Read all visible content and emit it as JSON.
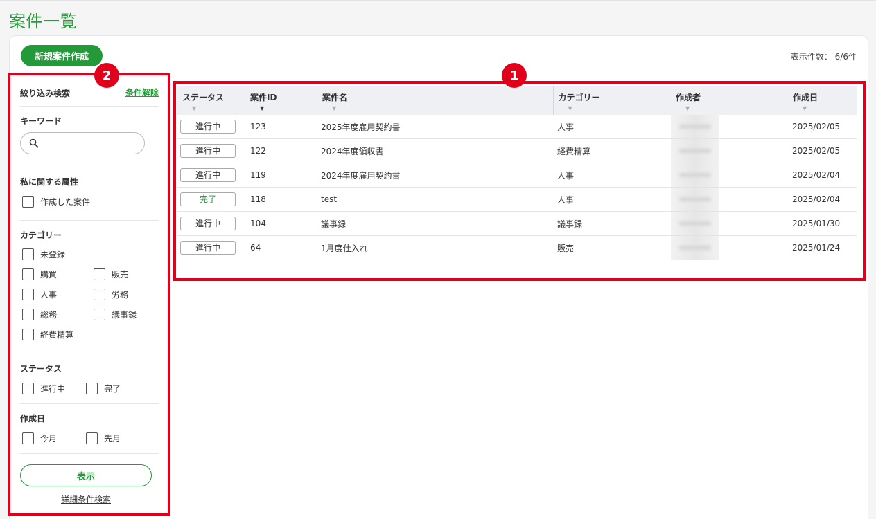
{
  "page_title": "案件一覧",
  "header": {
    "new_button": "新規案件作成",
    "count_label": "表示件数：",
    "count_value": "6/6件"
  },
  "filter": {
    "title": "絞り込み検索",
    "clear": "条件解除",
    "keyword": {
      "label": "キーワード",
      "placeholder": ""
    },
    "mine": {
      "label": "私に関する属性",
      "options": [
        "作成した案件"
      ]
    },
    "category": {
      "label": "カテゴリー",
      "options": [
        "未登録",
        "購買",
        "販売",
        "人事",
        "労務",
        "総務",
        "議事録",
        "経費精算"
      ]
    },
    "status": {
      "label": "ステータス",
      "options": [
        "進行中",
        "完了"
      ]
    },
    "created": {
      "label": "作成日",
      "options": [
        "今月",
        "先月"
      ]
    },
    "show_button": "表示",
    "advanced_link": "詳細条件検索"
  },
  "table": {
    "columns": [
      "ステータス",
      "案件ID",
      "案件名",
      "カテゴリー",
      "作成者",
      "作成日"
    ],
    "rows": [
      {
        "status": "進行中",
        "id": "123",
        "name": "2025年度雇用契約書",
        "category": "人事",
        "created": "2025/02/05"
      },
      {
        "status": "進行中",
        "id": "122",
        "name": "2024年度領収書",
        "category": "経費精算",
        "created": "2025/02/05"
      },
      {
        "status": "進行中",
        "id": "119",
        "name": "2024年度雇用契約書",
        "category": "人事",
        "created": "2025/02/04"
      },
      {
        "status": "完了",
        "id": "118",
        "name": "test",
        "category": "人事",
        "created": "2025/02/04"
      },
      {
        "status": "進行中",
        "id": "104",
        "name": "議事録",
        "category": "議事録",
        "created": "2025/01/30"
      },
      {
        "status": "進行中",
        "id": "64",
        "name": "1月度仕入れ",
        "category": "販売",
        "created": "2025/01/24"
      }
    ]
  },
  "annotations": {
    "badge_table": "1",
    "badge_filter": "2"
  },
  "colors": {
    "brand": "#23993a",
    "annotation": "#e0001b"
  }
}
